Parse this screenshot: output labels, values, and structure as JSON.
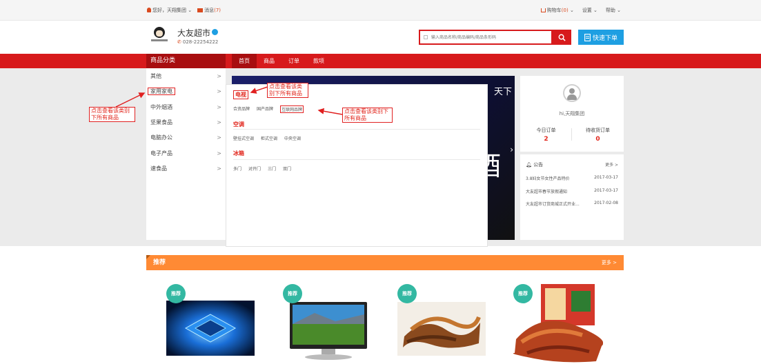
{
  "topbar": {
    "greeting": "您好，天翔集团",
    "messages_label": "消息",
    "messages_count": "(7)",
    "cart_label": "购物车",
    "cart_count": "(0)",
    "settings_label": "设置",
    "help_label": "帮助"
  },
  "header": {
    "shop_name": "大友超市",
    "phone": "028-22254222",
    "search_placeholder": "输入商品名称/商品编码/商品条形码",
    "quick_order_label": "快速下单"
  },
  "nav": {
    "category_title": "商品分类",
    "menu": [
      "首页",
      "商品",
      "订单",
      "款项"
    ]
  },
  "sidebar": {
    "items": [
      {
        "label": "其他"
      },
      {
        "label": "家用家电"
      },
      {
        "label": "中外烟酒"
      },
      {
        "label": "坚果食品"
      },
      {
        "label": "电脑办公"
      },
      {
        "label": "电子产品"
      },
      {
        "label": "速食品"
      }
    ],
    "arrow": ">"
  },
  "banner": {
    "text_top": "天下",
    "text_big": "酒",
    "next_arrow": "›"
  },
  "dropdown": {
    "sections": [
      {
        "title": "电视",
        "items": [
          "合资品牌",
          "国产品牌",
          "互联网品牌"
        ]
      },
      {
        "title": "空调",
        "items": [
          "壁挂式空调",
          "柜式空调",
          "中央空调"
        ]
      },
      {
        "title": "冰箱",
        "items": [
          "多门",
          "对开门",
          "三门",
          "双门"
        ]
      }
    ]
  },
  "user": {
    "name": "hi,天翔集团",
    "today_orders_label": "今日订单",
    "today_orders": "2",
    "pending_label": "待收货订单",
    "pending": "0"
  },
  "notice": {
    "title": "公告",
    "more": "更多 >",
    "rows": [
      {
        "title": "3.8妇女节女性产品特价",
        "date": "2017-03-17"
      },
      {
        "title": "大友超市春节放假通知",
        "date": "2017-03-17"
      },
      {
        "title": "大友超市订货商城正式开业...",
        "date": "2017-02-08"
      }
    ]
  },
  "annotations": {
    "left": "点击查看该类别下所有商品",
    "top": "点击查看该类别下所有商品",
    "mid": "点击查看该类别下所有商品"
  },
  "recommend": {
    "title": "推荐",
    "more": "更多 >",
    "badge": "推荐"
  },
  "colors": {
    "brand_red": "#d71a1c",
    "orange": "#ff8a34",
    "blue": "#1e9fe2",
    "teal": "#33b8a2"
  }
}
